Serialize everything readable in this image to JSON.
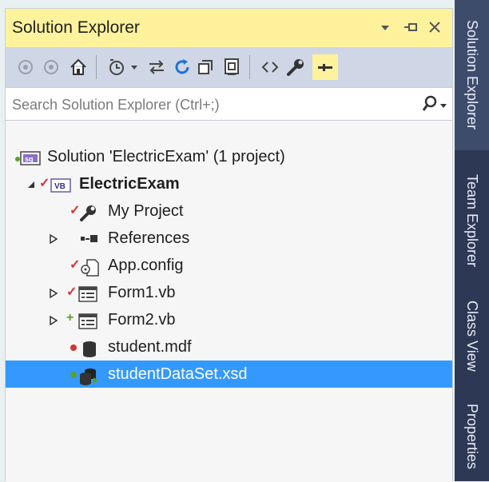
{
  "window": {
    "title": "Solution Explorer",
    "controls": {
      "dropdown_icon": "dropdown-arrow-icon",
      "pin_icon": "pin-icon",
      "close_icon": "close-icon"
    }
  },
  "toolbar": {
    "buttons": [
      {
        "name": "back-icon"
      },
      {
        "name": "forward-icon"
      },
      {
        "name": "home-icon"
      },
      {
        "name": "pending-changes-filter-icon"
      },
      {
        "name": "sync-with-active-document-icon"
      },
      {
        "name": "refresh-icon"
      },
      {
        "name": "collapse-all-icon"
      },
      {
        "name": "show-all-files-icon"
      },
      {
        "name": "view-code-icon"
      },
      {
        "name": "properties-icon"
      },
      {
        "name": "preview-selected-items-icon"
      }
    ]
  },
  "search": {
    "placeholder": "Search Solution Explorer (Ctrl+;)",
    "value": ""
  },
  "tree": {
    "items": [
      {
        "label": "Solution 'ElectricExam' (1 project)",
        "icon": "solution-icon",
        "level": 0
      },
      {
        "label": "ElectricExam",
        "icon": "vb-project-icon",
        "level": 1,
        "bold": true,
        "expanded": true,
        "status": "checked-in"
      },
      {
        "label": "My Project",
        "icon": "wrench-icon",
        "level": 2,
        "status": "checked-in"
      },
      {
        "label": "References",
        "icon": "references-icon",
        "level": 2,
        "expandable": true
      },
      {
        "label": "App.config",
        "icon": "config-file-icon",
        "level": 2,
        "status": "checked-in"
      },
      {
        "label": "Form1.vb",
        "icon": "form-icon",
        "level": 2,
        "expandable": true,
        "status": "checked-in"
      },
      {
        "label": "Form2.vb",
        "icon": "form-icon",
        "level": 2,
        "expandable": true,
        "status": "added"
      },
      {
        "label": "student.mdf",
        "icon": "database-icon",
        "level": 2,
        "status": "excluded"
      },
      {
        "label": "studentDataSet.xsd",
        "icon": "dataset-icon",
        "level": 2,
        "status": "added",
        "selected": true
      }
    ]
  },
  "side_tabs": [
    {
      "label": "Solution Explorer",
      "active": true
    },
    {
      "label": "Team Explorer"
    },
    {
      "label": "Class View"
    },
    {
      "label": "Properties"
    }
  ],
  "colors": {
    "title_bar": "#fff29d",
    "toolbar": "#cfd6e5",
    "selection": "#3399ff",
    "side_tabs": "#2d3954",
    "checkmark": "#d13438",
    "added": "#5aa02c"
  }
}
